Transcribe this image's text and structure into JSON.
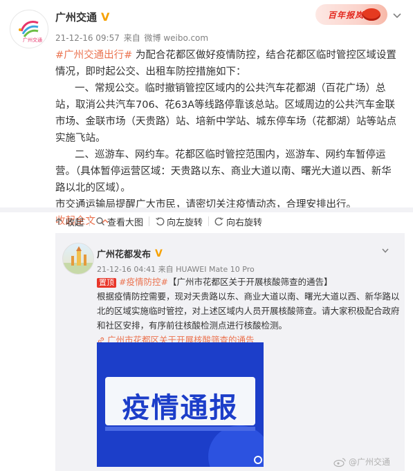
{
  "post": {
    "username": "广州交通",
    "verified_badge": "V",
    "meta": {
      "time": "21-12-16 09:57",
      "source_prefix": "来自",
      "source": "微博 weibo.com"
    },
    "avatar_text": "广州交通",
    "banner_text": "百年报岚甬",
    "hashtag": "#广州交通出行#",
    "para_intro": "为配合花都区做好疫情防控，结合花都区临时管控区域设置情况，即时起公交、出租车防控措施如下：",
    "para_1": "一、常规公交。临时撤销管控区域内的公共汽车花都湖（百花广场）总站，取消公共汽车706、花63A等线路停靠该总站。区域周边的公共汽车金联市场、金联市场（天贵路）站、培新中学站、城东停车场（花都湖）站等站点实施飞站。",
    "para_2": "二、巡游车、网约车。花都区临时管控范围内，巡游车、网约车暂停运营。（具体暂停运营区域：天贵路以东、商业大道以南、曙光大道以西、新华路以北的区域）。",
    "para_3": "市交通运输局提醒广大市民，请密切关注疫情动态，合理安排出行。",
    "collapse_label": "收起全文"
  },
  "toolbar": {
    "collapse": "收起",
    "view_large": "查看大图",
    "rotate_left": "向左旋转",
    "rotate_right": "向右旋转"
  },
  "retweet": {
    "username": "广州花都发布",
    "verified_badge": "V",
    "meta": {
      "time": "21-12-16 04:41",
      "source_prefix": "来自",
      "source": "HUAWEI Mate 10 Pro"
    },
    "pin_label": "置顶",
    "hashtag": "#疫情防控#",
    "headline": "【广州市花都区关于开展核酸筛查的通告】",
    "body": "根据疫情防控需要，现对天贵路以东、商业大道以南、曙光大道以西、新华路以北的区域实施临时管控，对上述区域内人员开展核酸筛查。请大家积极配合政府和社区安排，有序前往核酸检测点进行核酸检测。",
    "link_text": "广州市花都区关于开展核酸筛查的通告",
    "image_title": "疫情通报"
  },
  "watermark": "@广州交通",
  "colors": {
    "accent": "#eb7350",
    "verified": "#f6a100",
    "notice_blue": "#1c3ec9",
    "pin_red": "#e8362a"
  },
  "icons": [
    "collapse-arrow-icon",
    "magnifier-icon",
    "rotate-left-icon",
    "rotate-right-icon",
    "chevron-down-icon",
    "link-icon",
    "weibo-logo-icon"
  ]
}
